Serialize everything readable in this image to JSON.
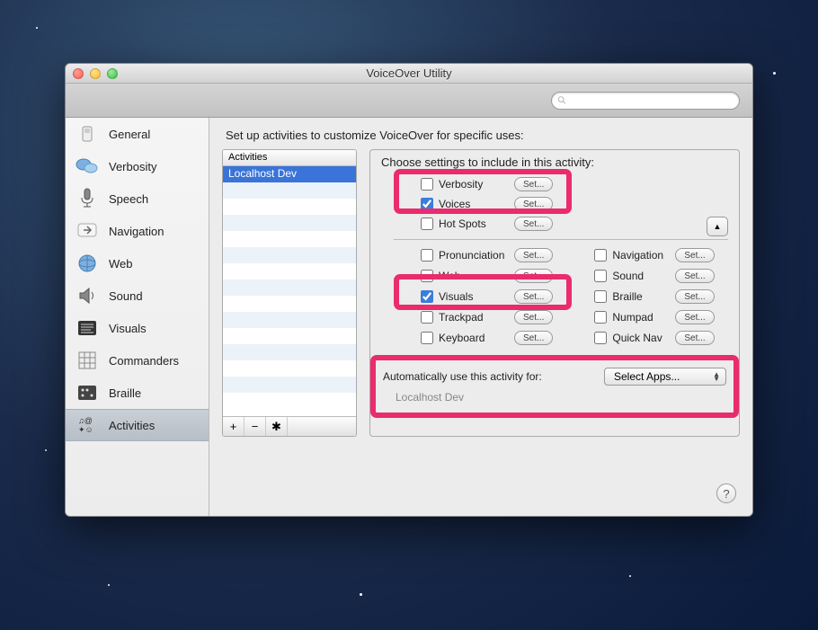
{
  "window": {
    "title": "VoiceOver Utility"
  },
  "search": {
    "placeholder": ""
  },
  "sidebar": {
    "items": [
      {
        "label": "General"
      },
      {
        "label": "Verbosity"
      },
      {
        "label": "Speech"
      },
      {
        "label": "Navigation"
      },
      {
        "label": "Web"
      },
      {
        "label": "Sound"
      },
      {
        "label": "Visuals"
      },
      {
        "label": "Commanders"
      },
      {
        "label": "Braille"
      },
      {
        "label": "Activities"
      }
    ]
  },
  "main": {
    "heading": "Set up activities to customize VoiceOver for specific uses:",
    "activities": {
      "header": "Activities",
      "rows": [
        {
          "name": "Localhost Dev",
          "selected": true
        }
      ]
    },
    "settings": {
      "heading": "Choose settings to include in this activity:",
      "set_label": "Set...",
      "top": [
        {
          "label": "Verbosity",
          "checked": false
        },
        {
          "label": "Voices",
          "checked": true
        },
        {
          "label": "Hot Spots",
          "checked": false
        }
      ],
      "colA": [
        {
          "label": "Pronunciation",
          "checked": false
        },
        {
          "label": "Web",
          "checked": false
        },
        {
          "label": "Visuals",
          "checked": true
        },
        {
          "label": "Trackpad",
          "checked": false
        },
        {
          "label": "Keyboard",
          "checked": false
        }
      ],
      "colB": [
        {
          "label": "Navigation",
          "checked": false
        },
        {
          "label": "Sound",
          "checked": false
        },
        {
          "label": "Braille",
          "checked": false
        },
        {
          "label": "Numpad",
          "checked": false
        },
        {
          "label": "Quick Nav",
          "checked": false
        }
      ]
    },
    "auto": {
      "label": "Automatically use this activity for:",
      "select_label": "Select Apps...",
      "value": "Localhost Dev"
    }
  }
}
